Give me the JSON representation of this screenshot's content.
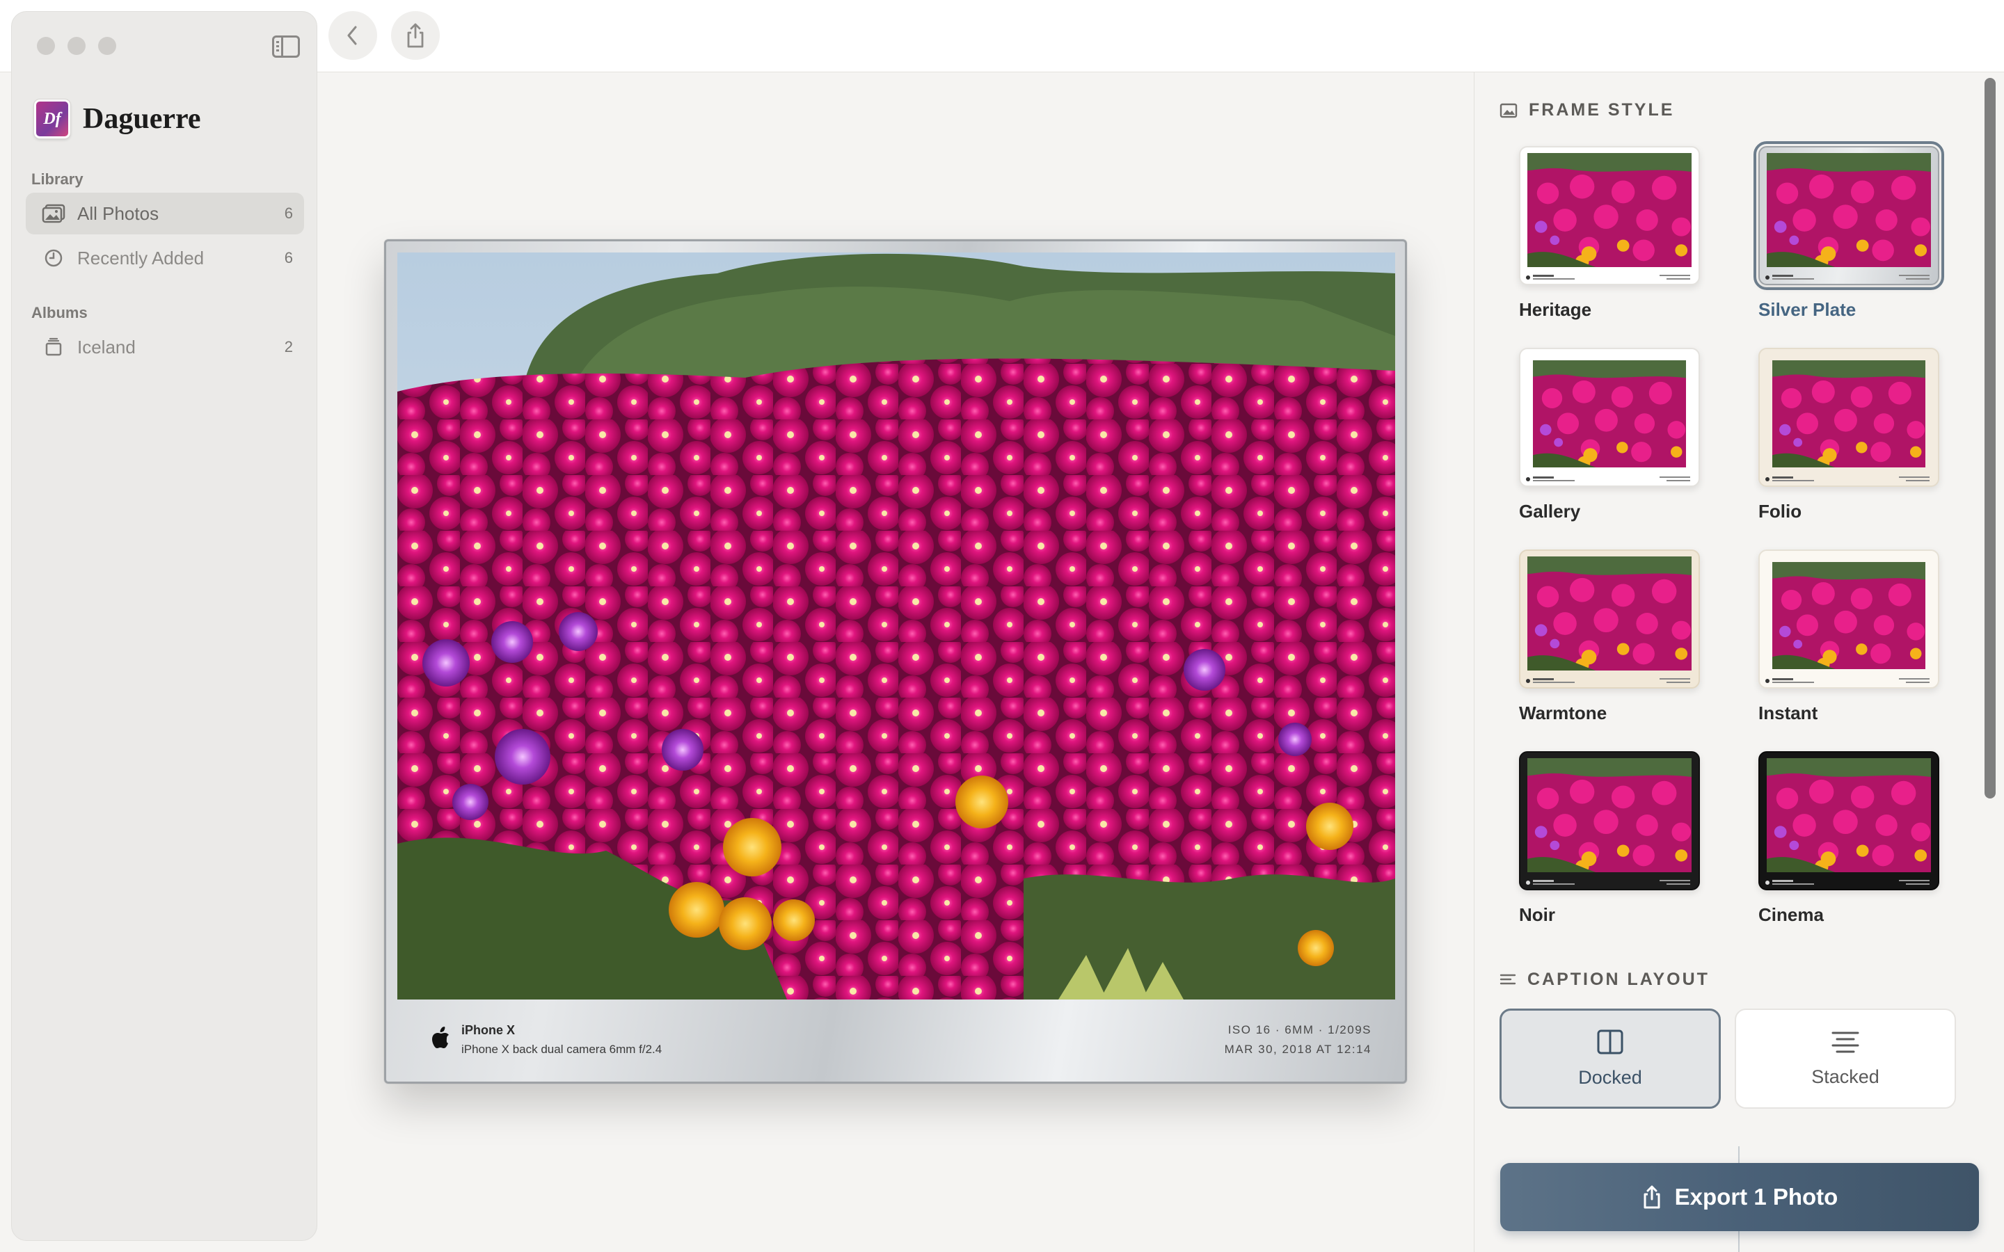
{
  "app": {
    "name": "Daguerre",
    "logo_text": "Df"
  },
  "sidebar": {
    "library_label": "Library",
    "albums_label": "Albums",
    "library_items": [
      {
        "label": "All Photos",
        "count": "6",
        "icon": "photos-icon"
      },
      {
        "label": "Recently Added",
        "count": "6",
        "icon": "clock-icon"
      }
    ],
    "album_items": [
      {
        "label": "Iceland",
        "count": "2",
        "icon": "album-icon"
      }
    ]
  },
  "toolbar": {
    "back_icon": "chevron-left-icon",
    "share_icon": "share-icon",
    "sidebar_toggle_icon": "sidebar-toggle-icon"
  },
  "preview": {
    "frame_style": "Silver Plate",
    "caption": {
      "camera": "iPhone X",
      "lens": "iPhone X back dual camera 6mm f/2.4",
      "exposure": "ISO 16 · 6MM · 1/209S",
      "date": "MAR 30, 2018 AT 12:14"
    }
  },
  "panel": {
    "frame_style_heading": "FRAME STYLE",
    "caption_layout_heading": "CAPTION LAYOUT",
    "frame_styles": [
      {
        "label": "Heritage",
        "selected": false
      },
      {
        "label": "Silver Plate",
        "selected": true
      },
      {
        "label": "Gallery",
        "selected": false
      },
      {
        "label": "Folio",
        "selected": false
      },
      {
        "label": "Warmtone",
        "selected": false
      },
      {
        "label": "Instant",
        "selected": false
      },
      {
        "label": "Noir",
        "selected": false
      },
      {
        "label": "Cinema",
        "selected": false
      }
    ],
    "caption_layouts": [
      {
        "label": "Docked",
        "selected": true,
        "icon": "split-panel-icon"
      },
      {
        "label": "Stacked",
        "selected": false,
        "icon": "align-lines-icon"
      }
    ],
    "export_label": "Export 1 Photo"
  },
  "colors": {
    "accent": "#4a6178",
    "selected_text": "#456582",
    "flower_magenta": "#c8106e"
  }
}
